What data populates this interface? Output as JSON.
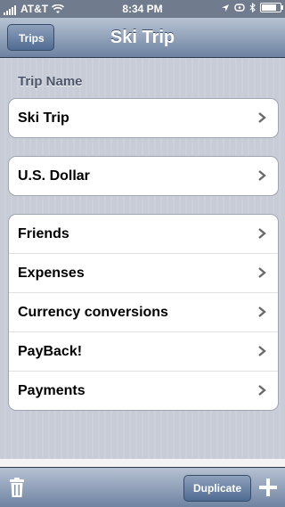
{
  "status_bar": {
    "carrier": "AT&T",
    "time": "8:34 PM"
  },
  "nav": {
    "back_label": "Trips",
    "title": "Ski Trip"
  },
  "trip_section": {
    "header": "Trip Name",
    "name_value": "Ski Trip"
  },
  "currency": {
    "value": "U.S. Dollar"
  },
  "menu": {
    "items": [
      {
        "label": "Friends"
      },
      {
        "label": "Expenses"
      },
      {
        "label": "Currency conversions"
      },
      {
        "label": "PayBack!"
      },
      {
        "label": "Payments"
      }
    ]
  },
  "toolbar": {
    "duplicate_label": "Duplicate"
  },
  "icons": {
    "trash": "trash-icon",
    "add": "plus-icon",
    "chevron": "chevron-right-icon"
  }
}
